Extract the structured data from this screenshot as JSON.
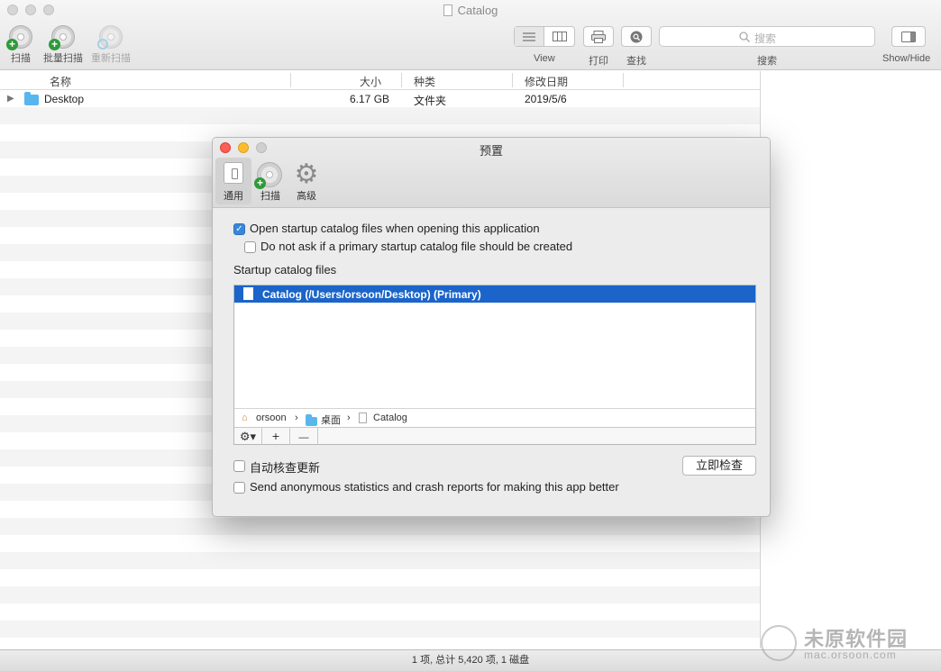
{
  "window": {
    "title": "Catalog"
  },
  "toolbar": {
    "scan": "扫描",
    "batch_scan": "批量扫描",
    "rescan": "重新扫描",
    "view": "View",
    "print": "打印",
    "find": "查找",
    "search_label": "搜索",
    "search_placeholder": "搜索",
    "show_hide": "Show/Hide"
  },
  "table": {
    "columns": [
      "名称",
      "大小",
      "种类",
      "修改日期"
    ],
    "rows": [
      {
        "name": "Desktop",
        "size": "6.17 GB",
        "kind": "文件夹",
        "date": "2019/5/6"
      }
    ]
  },
  "status": "1 项, 总计 5,420 项, 1 磁盘",
  "dialog": {
    "title": "预置",
    "tabs": [
      "通用",
      "扫描",
      "高级"
    ],
    "opt_open_startup": "Open startup catalog files when opening this application",
    "opt_open_startup_checked": true,
    "opt_do_not_ask": "Do not ask if a primary startup catalog file should be created",
    "opt_do_not_ask_checked": false,
    "startup_files_label": "Startup catalog files",
    "startup_files": [
      "Catalog (/Users/orsoon/Desktop) (Primary)"
    ],
    "path": [
      "orsoon",
      "桌面",
      "Catalog"
    ],
    "path_sep": "›",
    "tools": {
      "plus": "+",
      "minus": "—"
    },
    "opt_auto_update": "自动核查更新",
    "opt_auto_update_checked": false,
    "check_now": "立即检查",
    "opt_anonymous": "Send anonymous statistics and crash reports for making this app better",
    "opt_anonymous_checked": false
  },
  "watermark": {
    "big": "未原软件园",
    "small": "mac.orsoon.com"
  },
  "colors": {
    "selection": "#1b64c9",
    "checkbox_on": "#3a86d8",
    "close": "#fc5f57",
    "minimize": "#fdbc2e"
  }
}
